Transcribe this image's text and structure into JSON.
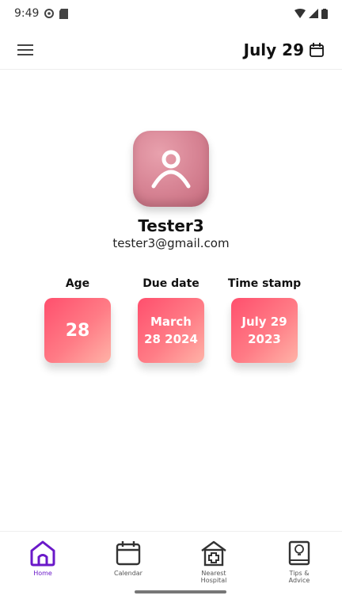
{
  "status_bar": {
    "time": "9:49"
  },
  "header": {
    "date": "July 29"
  },
  "profile": {
    "name": "Tester3",
    "email": "tester3@gmail.com"
  },
  "stats": [
    {
      "label": "Age",
      "line1": "28",
      "line2": ""
    },
    {
      "label": "Due date",
      "line1": "March",
      "line2": "28 2024"
    },
    {
      "label": "Time stamp",
      "line1": "July 29",
      "line2": "2023"
    }
  ],
  "nav": [
    {
      "label": "Home",
      "icon": "home-icon",
      "active": true
    },
    {
      "label": "Calendar",
      "icon": "calendar-icon",
      "active": false
    },
    {
      "label_line1": "Nearest",
      "label_line2": "Hospital",
      "icon": "hospital-icon",
      "active": false
    },
    {
      "label_line1": "Tips &",
      "label_line2": "Advice",
      "icon": "tips-book-icon",
      "active": false
    }
  ],
  "colors": {
    "accent": "#6a19c9",
    "card_gradient_start": "#ff4f6d",
    "card_gradient_end": "#ffb3a7",
    "avatar": "#d98797"
  }
}
